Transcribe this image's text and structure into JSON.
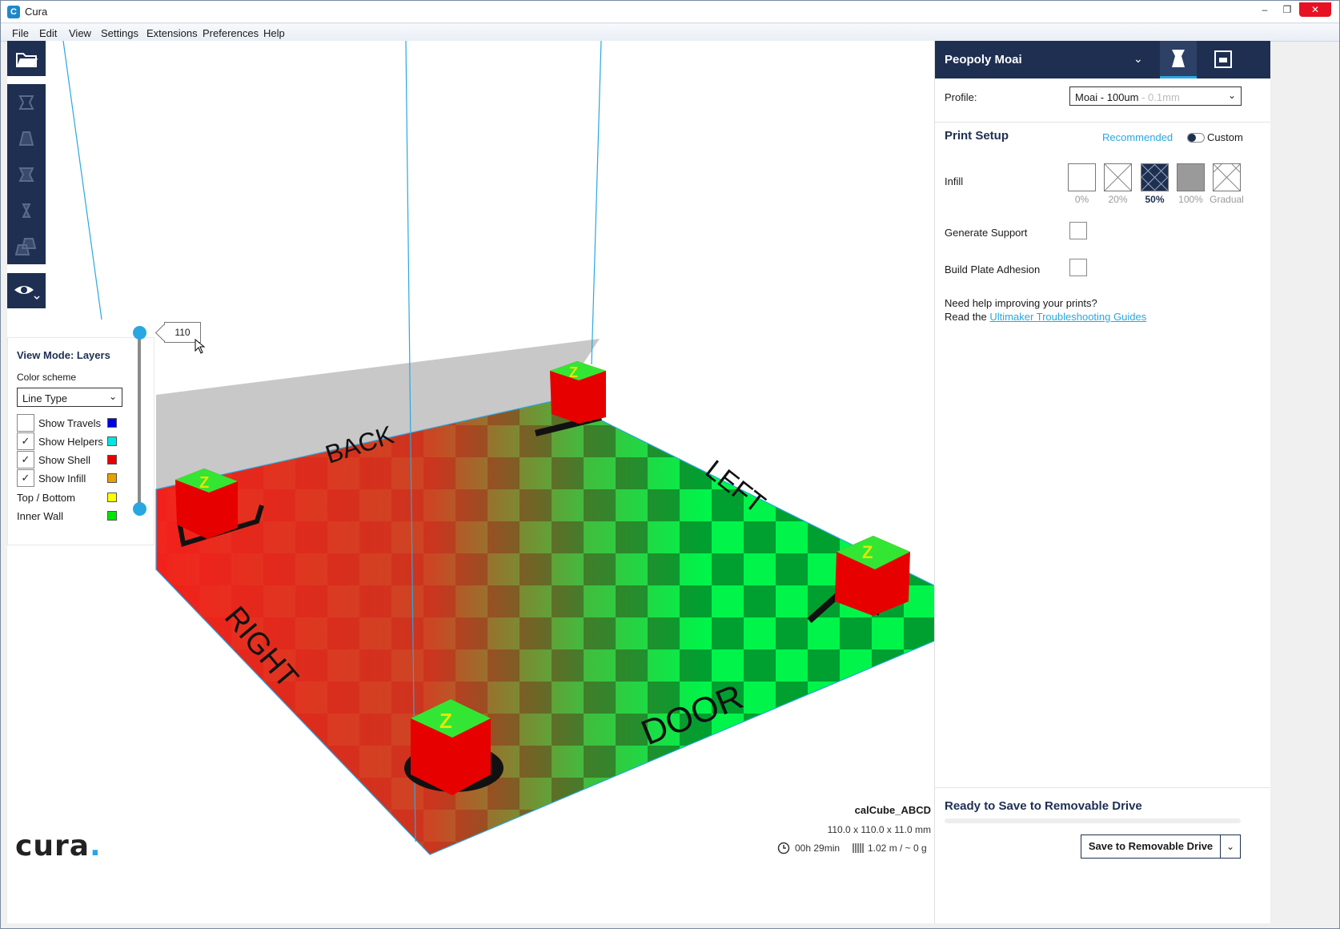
{
  "window": {
    "title": "Cura"
  },
  "menu": [
    "File",
    "Edit",
    "View",
    "Settings",
    "Extensions",
    "Preferences",
    "Help"
  ],
  "viewport": {
    "bed_labels": {
      "back": "BACK",
      "left": "LEFT",
      "right": "RIGHT",
      "door": "DOOR"
    },
    "cube_letter": "Z"
  },
  "layer_view": {
    "title": "View Mode: Layers",
    "color_scheme_label": "Color scheme",
    "color_scheme_value": "Line Type",
    "options": [
      {
        "label": "Show Travels",
        "checked": false,
        "color": "#0000e6"
      },
      {
        "label": "Show Helpers",
        "checked": true,
        "color": "#00e6e6"
      },
      {
        "label": "Show Shell",
        "checked": true,
        "color": "#e60000"
      },
      {
        "label": "Show Infill",
        "checked": true,
        "color": "#e6a000"
      }
    ],
    "legend": [
      {
        "label": "Top / Bottom",
        "color": "#ffff00"
      },
      {
        "label": "Inner Wall",
        "color": "#00e600"
      }
    ],
    "current_layer": "110",
    "checkmark": "✓"
  },
  "job": {
    "name": "calCube_ABCD",
    "dimensions": "110.0 x 110.0 x 11.0 mm",
    "time": "00h 29min",
    "material": "1.02 m / ~ 0 g"
  },
  "logo": {
    "text": "cura",
    "dot": "."
  },
  "sidebar": {
    "printer": "Peopoly Moai",
    "profile_label": "Profile:",
    "profile_value": "Moai - 100um",
    "profile_sub": " - 0.1mm",
    "print_setup": "Print Setup",
    "recommended": "Recommended",
    "custom": "Custom",
    "infill_label": "Infill",
    "infill_options": [
      "0%",
      "20%",
      "50%",
      "100%",
      "Gradual"
    ],
    "infill_selected": "50%",
    "generate_support": "Generate Support",
    "build_plate_adhesion": "Build Plate Adhesion",
    "help_line1": "Need help improving your prints?",
    "help_line2_prefix": "Read the ",
    "help_link": "Ultimaker Troubleshooting Guides",
    "save_status": "Ready to Save to Removable Drive",
    "save_button": "Save to Removable Drive",
    "save_progress": 0
  },
  "colors": {
    "header": "#1e2f52",
    "accent": "#29a7e1",
    "bed_light": "#00f44a",
    "bed_dark": "#00a030",
    "shell": "#e60000"
  }
}
